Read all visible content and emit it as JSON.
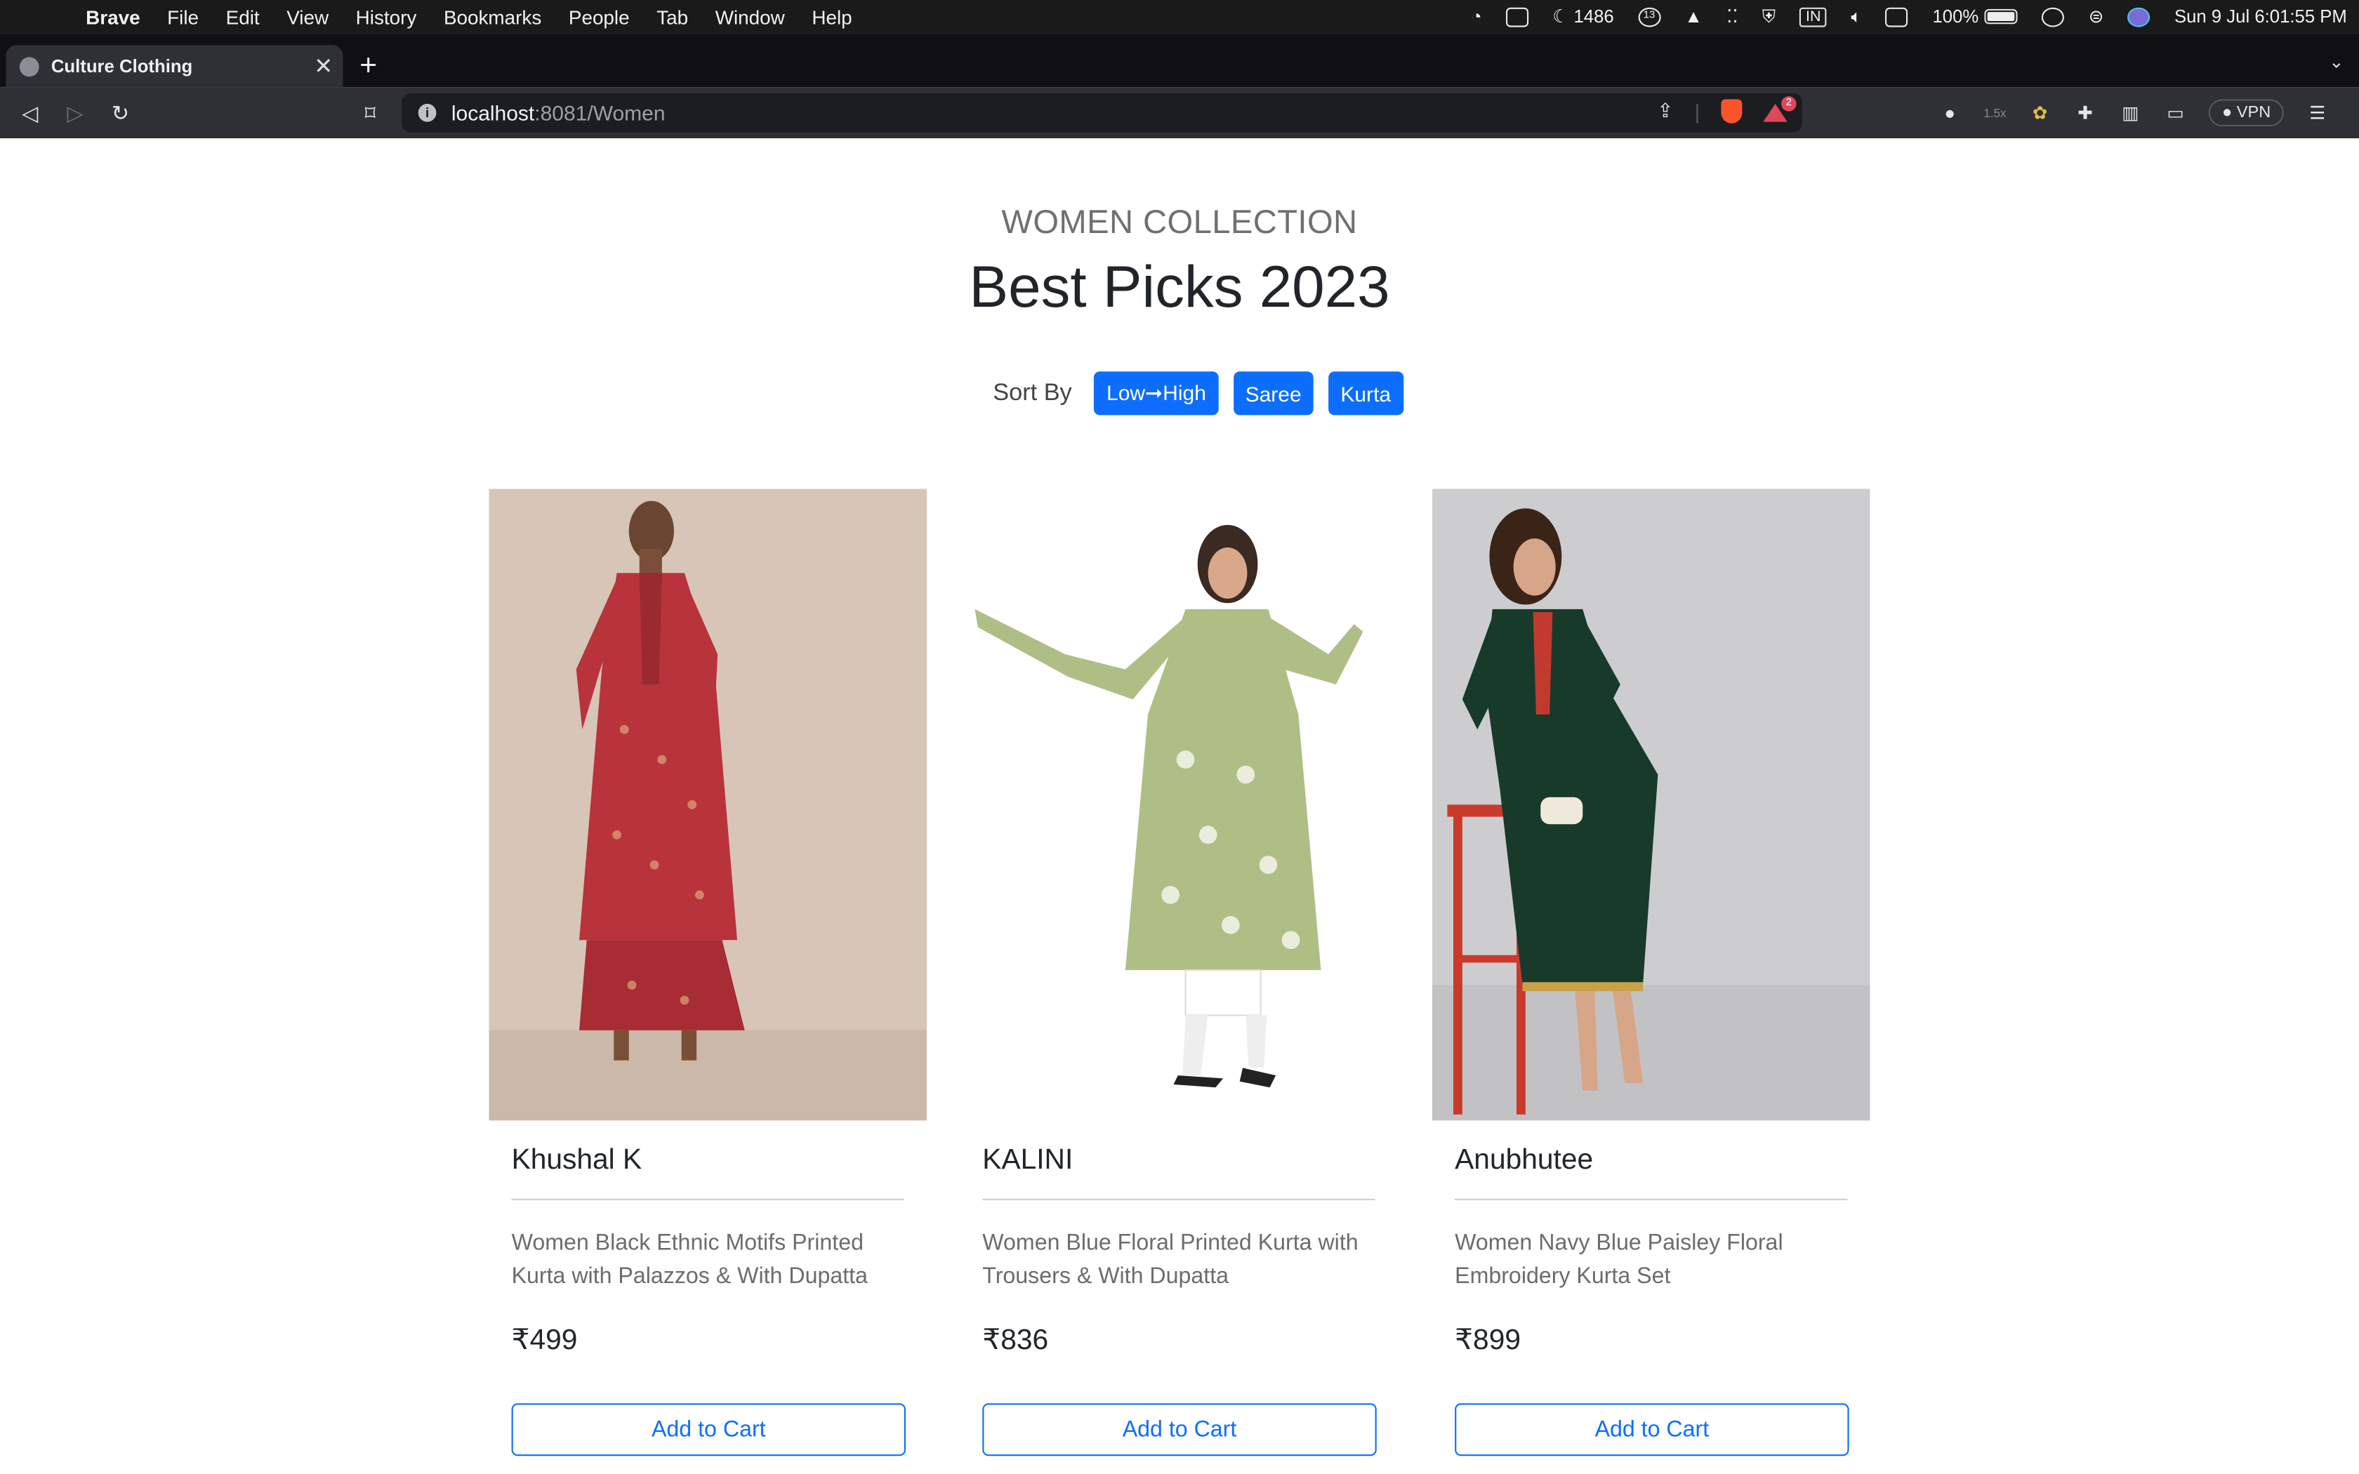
{
  "menubar": {
    "app": "Brave",
    "items": [
      "File",
      "Edit",
      "View",
      "History",
      "Bookmarks",
      "People",
      "Tab",
      "Window",
      "Help"
    ],
    "moon_count": "1486",
    "notif_badge": "13",
    "keyboard": "IN",
    "battery": "100%",
    "datetime": "Sun 9 Jul  6:01:55 PM"
  },
  "browser": {
    "tab_title": "Culture Clothing",
    "url_host": "localhost",
    "url_path": ":8081/Women",
    "rewards_badge": "2",
    "zoom_label": "1.5x",
    "vpn_label": "VPN"
  },
  "page": {
    "eyebrow": "WOMEN COLLECTION",
    "headline": "Best Picks 2023",
    "sort_label": "Sort By",
    "sort_buttons": [
      "Low➞High",
      "Saree",
      "Kurta"
    ],
    "products": [
      {
        "brand": "Khushal K",
        "description": "Women Black Ethnic Motifs Printed Kurta with Palazzos & With Dupatta",
        "price": "₹499",
        "cart_label": "Add to Cart"
      },
      {
        "brand": "KALINI",
        "description": "Women Blue Floral Printed Kurta with Trousers & With Dupatta",
        "price": "₹836",
        "cart_label": "Add to Cart"
      },
      {
        "brand": "Anubhutee",
        "description": "Women Navy Blue Paisley Floral Embroidery Kurta Set",
        "price": "₹899",
        "cart_label": "Add to Cart"
      }
    ]
  },
  "colors": {
    "primary": "#0d6efd",
    "photo1_bg": "#d7c6b8",
    "photo1_garment": "#b8333a",
    "photo2_garment": "#aebe85",
    "photo3_bg": "#cdcdcf",
    "photo3_garment": "#173a2a"
  }
}
